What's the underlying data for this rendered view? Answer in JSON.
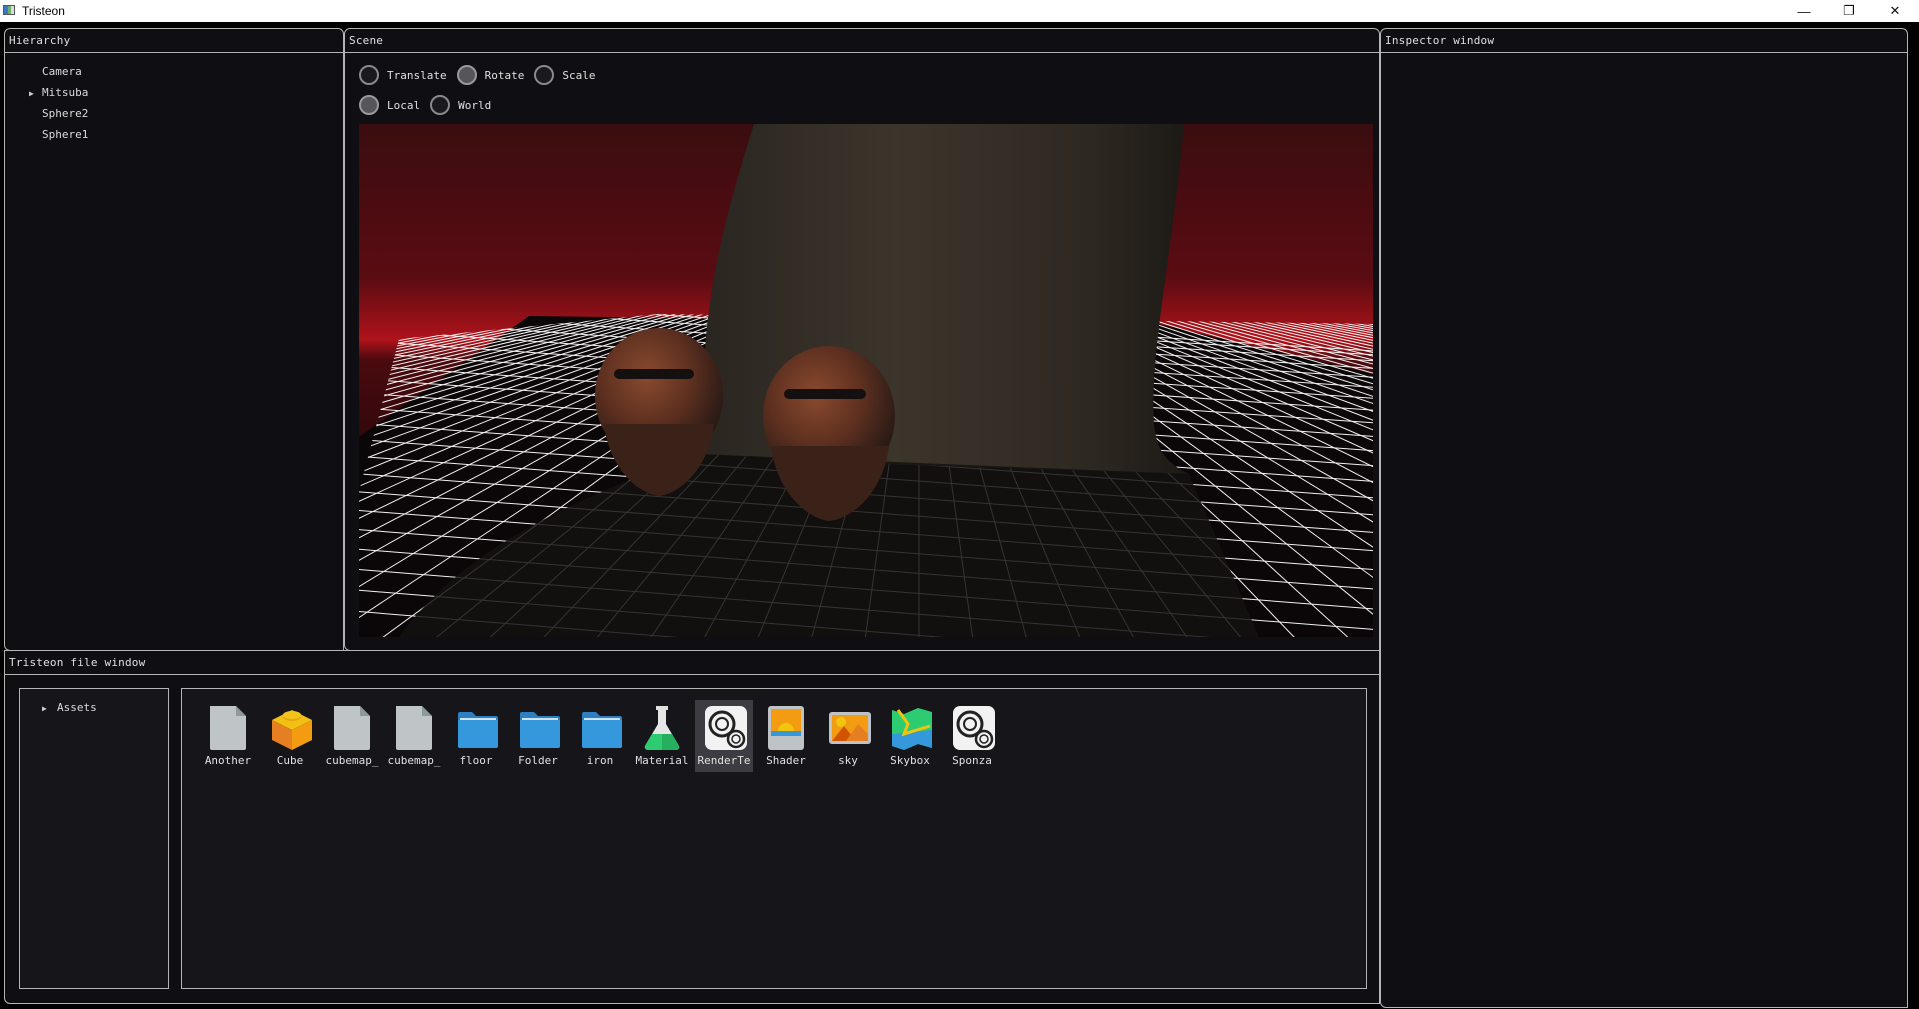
{
  "window": {
    "title": "Tristeon",
    "controls": {
      "minimize": "—",
      "restore": "❐",
      "close": "✕"
    }
  },
  "hierarchy": {
    "title": "Hierarchy",
    "items": [
      {
        "label": "Camera",
        "expandable": false
      },
      {
        "label": "Mitsuba",
        "expandable": true
      },
      {
        "label": "Sphere2",
        "expandable": false
      },
      {
        "label": "Sphere1",
        "expandable": false
      }
    ],
    "arrow": "▶"
  },
  "scene": {
    "title": "Scene",
    "gizmo_modes": [
      {
        "label": "Translate",
        "selected": false
      },
      {
        "label": "Rotate",
        "selected": true
      },
      {
        "label": "Scale",
        "selected": false
      }
    ],
    "spaces": [
      {
        "label": "Local",
        "selected": true
      },
      {
        "label": "World",
        "selected": false
      }
    ],
    "colors": {
      "sky": "#5a0c12",
      "horizon": "#c0101a",
      "grid": "#ffffff"
    }
  },
  "inspector": {
    "title": "Inspector window"
  },
  "files": {
    "title": "Tristeon file window",
    "tree": {
      "arrow": "▶",
      "root": "Assets"
    },
    "selected": "RenderTe",
    "items": [
      {
        "label": "Another",
        "icon": "file-icon"
      },
      {
        "label": "Cube",
        "icon": "cube-icon"
      },
      {
        "label": "cubemap_",
        "icon": "file-icon"
      },
      {
        "label": "cubemap_",
        "icon": "file-icon"
      },
      {
        "label": "floor",
        "icon": "folder-icon"
      },
      {
        "label": "Folder",
        "icon": "folder-icon"
      },
      {
        "label": "iron",
        "icon": "folder-icon"
      },
      {
        "label": "Material",
        "icon": "flask-icon"
      },
      {
        "label": "RenderTe",
        "icon": "gears-icon"
      },
      {
        "label": "Shader",
        "icon": "sunset-icon"
      },
      {
        "label": "sky",
        "icon": "image-icon"
      },
      {
        "label": "Skybox",
        "icon": "map-icon"
      },
      {
        "label": "Sponza",
        "icon": "gears-icon"
      }
    ]
  }
}
